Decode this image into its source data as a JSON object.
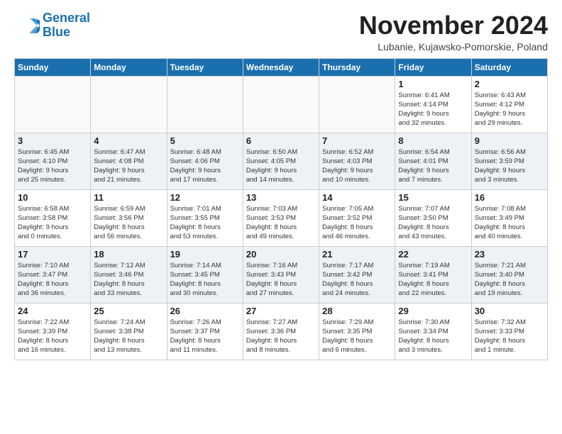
{
  "header": {
    "logo_line1": "General",
    "logo_line2": "Blue",
    "month_title": "November 2024",
    "subtitle": "Lubanie, Kujawsko-Pomorskie, Poland"
  },
  "weekdays": [
    "Sunday",
    "Monday",
    "Tuesday",
    "Wednesday",
    "Thursday",
    "Friday",
    "Saturday"
  ],
  "weeks": [
    [
      {
        "day": "",
        "info": ""
      },
      {
        "day": "",
        "info": ""
      },
      {
        "day": "",
        "info": ""
      },
      {
        "day": "",
        "info": ""
      },
      {
        "day": "",
        "info": ""
      },
      {
        "day": "1",
        "info": "Sunrise: 6:41 AM\nSunset: 4:14 PM\nDaylight: 9 hours\nand 32 minutes."
      },
      {
        "day": "2",
        "info": "Sunrise: 6:43 AM\nSunset: 4:12 PM\nDaylight: 9 hours\nand 29 minutes."
      }
    ],
    [
      {
        "day": "3",
        "info": "Sunrise: 6:45 AM\nSunset: 4:10 PM\nDaylight: 9 hours\nand 25 minutes."
      },
      {
        "day": "4",
        "info": "Sunrise: 6:47 AM\nSunset: 4:08 PM\nDaylight: 9 hours\nand 21 minutes."
      },
      {
        "day": "5",
        "info": "Sunrise: 6:48 AM\nSunset: 4:06 PM\nDaylight: 9 hours\nand 17 minutes."
      },
      {
        "day": "6",
        "info": "Sunrise: 6:50 AM\nSunset: 4:05 PM\nDaylight: 9 hours\nand 14 minutes."
      },
      {
        "day": "7",
        "info": "Sunrise: 6:52 AM\nSunset: 4:03 PM\nDaylight: 9 hours\nand 10 minutes."
      },
      {
        "day": "8",
        "info": "Sunrise: 6:54 AM\nSunset: 4:01 PM\nDaylight: 9 hours\nand 7 minutes."
      },
      {
        "day": "9",
        "info": "Sunrise: 6:56 AM\nSunset: 3:59 PM\nDaylight: 9 hours\nand 3 minutes."
      }
    ],
    [
      {
        "day": "10",
        "info": "Sunrise: 6:58 AM\nSunset: 3:58 PM\nDaylight: 9 hours\nand 0 minutes."
      },
      {
        "day": "11",
        "info": "Sunrise: 6:59 AM\nSunset: 3:56 PM\nDaylight: 8 hours\nand 56 minutes."
      },
      {
        "day": "12",
        "info": "Sunrise: 7:01 AM\nSunset: 3:55 PM\nDaylight: 8 hours\nand 53 minutes."
      },
      {
        "day": "13",
        "info": "Sunrise: 7:03 AM\nSunset: 3:53 PM\nDaylight: 8 hours\nand 49 minutes."
      },
      {
        "day": "14",
        "info": "Sunrise: 7:05 AM\nSunset: 3:52 PM\nDaylight: 8 hours\nand 46 minutes."
      },
      {
        "day": "15",
        "info": "Sunrise: 7:07 AM\nSunset: 3:50 PM\nDaylight: 8 hours\nand 43 minutes."
      },
      {
        "day": "16",
        "info": "Sunrise: 7:08 AM\nSunset: 3:49 PM\nDaylight: 8 hours\nand 40 minutes."
      }
    ],
    [
      {
        "day": "17",
        "info": "Sunrise: 7:10 AM\nSunset: 3:47 PM\nDaylight: 8 hours\nand 36 minutes."
      },
      {
        "day": "18",
        "info": "Sunrise: 7:12 AM\nSunset: 3:46 PM\nDaylight: 8 hours\nand 33 minutes."
      },
      {
        "day": "19",
        "info": "Sunrise: 7:14 AM\nSunset: 3:45 PM\nDaylight: 8 hours\nand 30 minutes."
      },
      {
        "day": "20",
        "info": "Sunrise: 7:16 AM\nSunset: 3:43 PM\nDaylight: 8 hours\nand 27 minutes."
      },
      {
        "day": "21",
        "info": "Sunrise: 7:17 AM\nSunset: 3:42 PM\nDaylight: 8 hours\nand 24 minutes."
      },
      {
        "day": "22",
        "info": "Sunrise: 7:19 AM\nSunset: 3:41 PM\nDaylight: 8 hours\nand 22 minutes."
      },
      {
        "day": "23",
        "info": "Sunrise: 7:21 AM\nSunset: 3:40 PM\nDaylight: 8 hours\nand 19 minutes."
      }
    ],
    [
      {
        "day": "24",
        "info": "Sunrise: 7:22 AM\nSunset: 3:39 PM\nDaylight: 8 hours\nand 16 minutes."
      },
      {
        "day": "25",
        "info": "Sunrise: 7:24 AM\nSunset: 3:38 PM\nDaylight: 8 hours\nand 13 minutes."
      },
      {
        "day": "26",
        "info": "Sunrise: 7:26 AM\nSunset: 3:37 PM\nDaylight: 8 hours\nand 11 minutes."
      },
      {
        "day": "27",
        "info": "Sunrise: 7:27 AM\nSunset: 3:36 PM\nDaylight: 8 hours\nand 8 minutes."
      },
      {
        "day": "28",
        "info": "Sunrise: 7:29 AM\nSunset: 3:35 PM\nDaylight: 8 hours\nand 6 minutes."
      },
      {
        "day": "29",
        "info": "Sunrise: 7:30 AM\nSunset: 3:34 PM\nDaylight: 8 hours\nand 3 minutes."
      },
      {
        "day": "30",
        "info": "Sunrise: 7:32 AM\nSunset: 3:33 PM\nDaylight: 8 hours\nand 1 minute."
      }
    ]
  ]
}
